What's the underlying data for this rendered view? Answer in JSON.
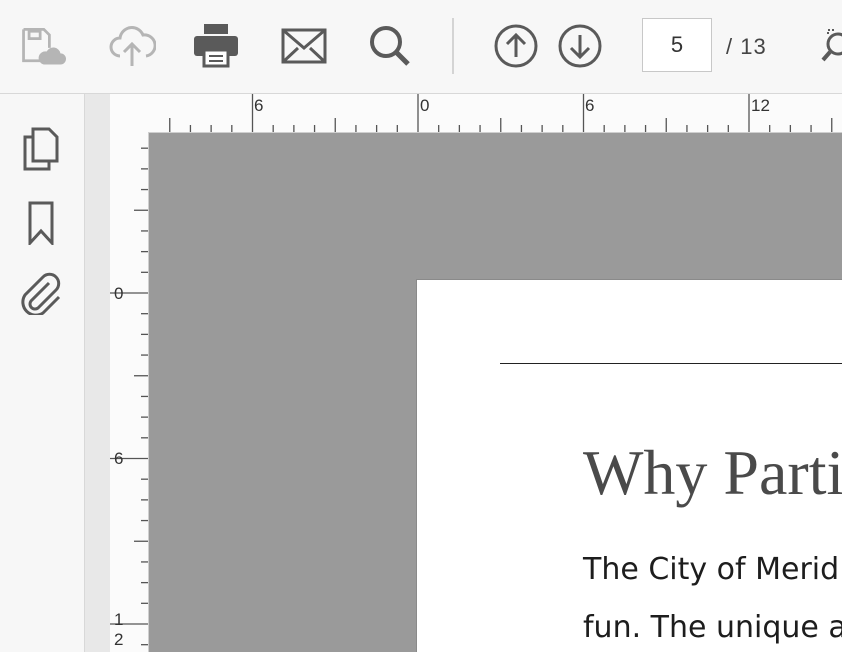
{
  "toolbar": {
    "icons": [
      "save-cloud-icon",
      "upload-cloud-icon",
      "print-icon",
      "mail-icon",
      "search-icon",
      "previous-page-icon",
      "next-page-icon",
      "zoom-icon"
    ],
    "current_page": "5",
    "page_total": "/ 13"
  },
  "left_rail": {
    "icons": [
      "pages-icon",
      "bookmark-icon",
      "attachment-icon"
    ]
  },
  "rulers": {
    "top_labels": [
      "6",
      "0",
      "6",
      "12"
    ],
    "left_labels": [
      "0",
      "6",
      "1",
      "2"
    ]
  },
  "document": {
    "heading": "Why Parti",
    "lines": [
      "The City of Merid",
      "fun. The unique a"
    ]
  },
  "colors": {
    "canvas": "#9a9a9a",
    "icon": "#5a5a5a",
    "icon_disabled": "#b5b5b5"
  }
}
